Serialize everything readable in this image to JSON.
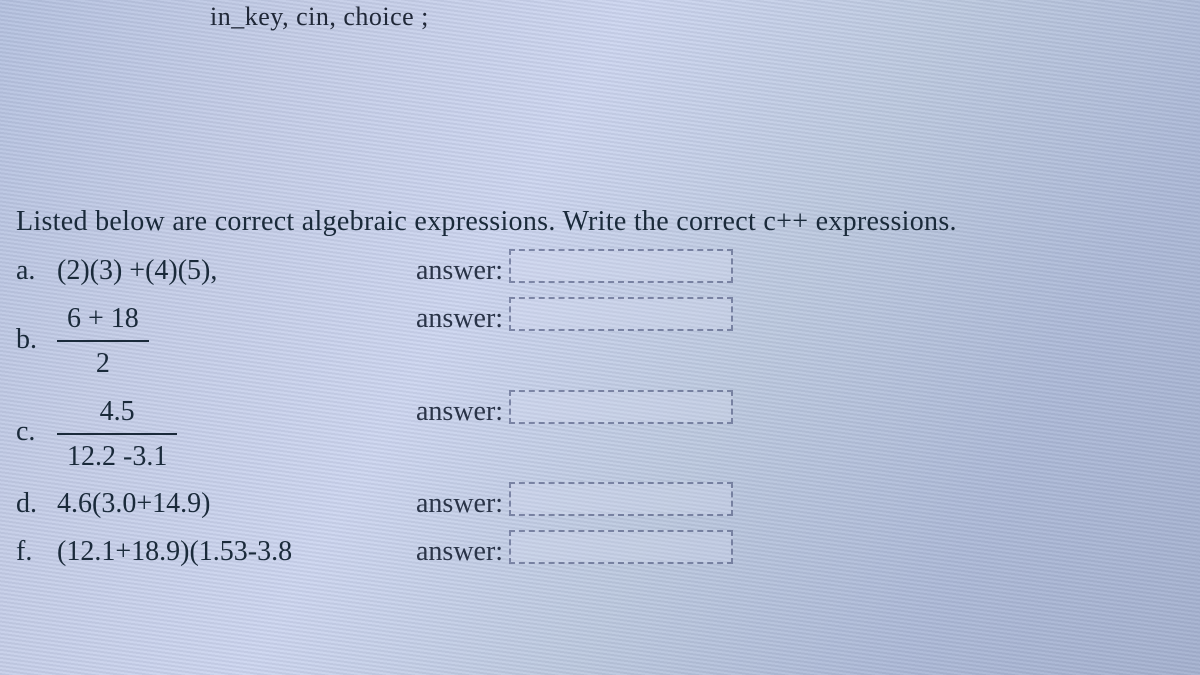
{
  "top_crop": "in_key, cin, choice ;",
  "prompt": "Listed below are correct algebraic expressions.  Write the correct c++ expressions.",
  "items": {
    "a": {
      "label": "a.",
      "expr": "(2)(3) +(4)(5),",
      "ans_label": "answer:"
    },
    "b": {
      "label": "b.",
      "num": "6 + 18",
      "den": "2",
      "ans_label": "answer:"
    },
    "c": {
      "label": "c.",
      "num": "4.5",
      "den": "12.2 -3.1",
      "ans_label": "answer:"
    },
    "d": {
      "label": "d.",
      "expr": "4.6(3.0+14.9)",
      "ans_label": "answer:"
    },
    "f": {
      "label": "f.",
      "expr": "(12.1+18.9)(1.53-3.8",
      "ans_label": "answer:"
    }
  }
}
